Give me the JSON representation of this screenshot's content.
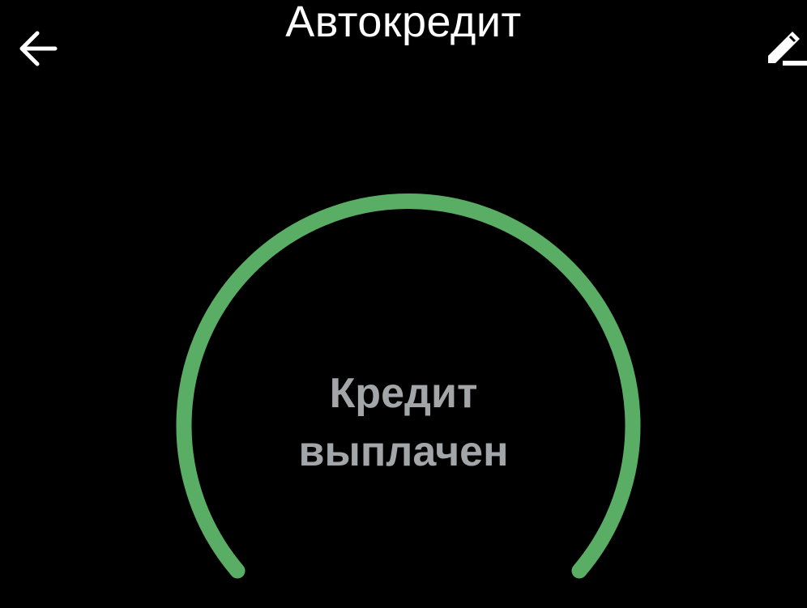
{
  "header": {
    "title": "Автокредит",
    "back_icon": "arrow-left-icon",
    "edit_icon": "pencil-icon"
  },
  "progress": {
    "fraction_paid": 1.0,
    "status_line1": "Кредит",
    "status_line2": "выплачен"
  },
  "colors": {
    "background": "#000000",
    "arc": "#5aad65",
    "title": "#ffffff",
    "status_text": "#a3a6a9"
  }
}
